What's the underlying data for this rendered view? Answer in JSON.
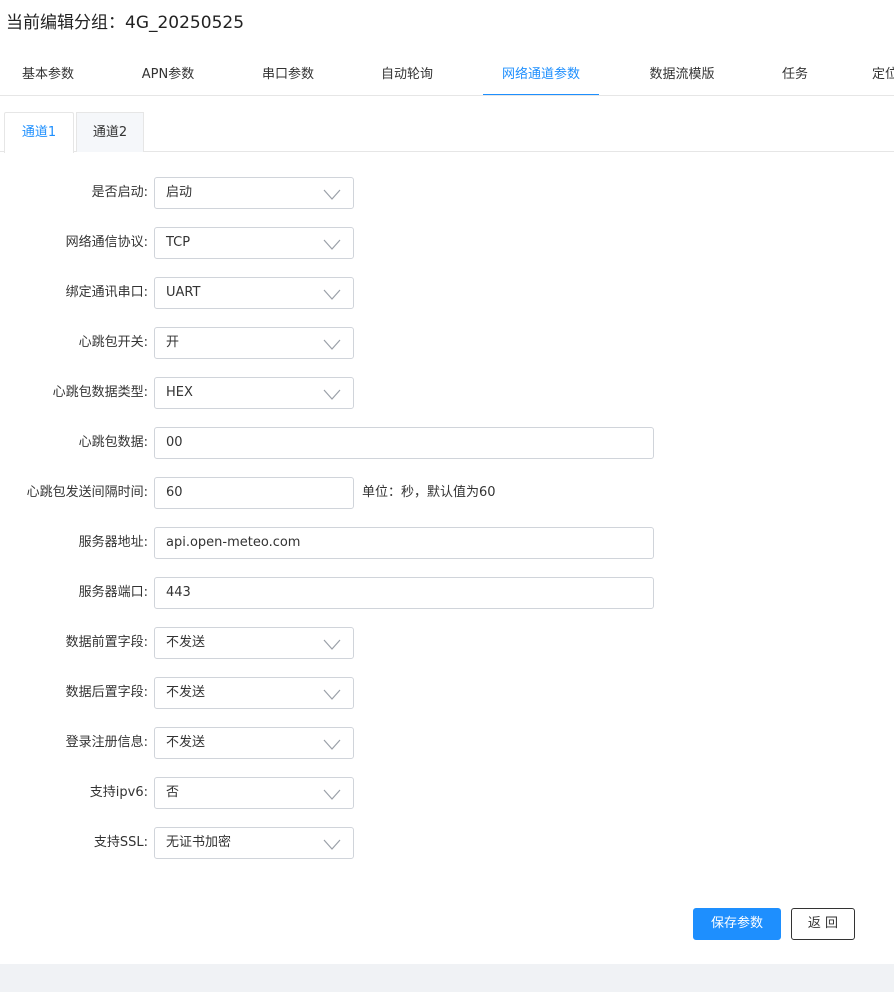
{
  "header": {
    "title": "当前编辑分组：4G_20250525"
  },
  "main_tabs": [
    {
      "label": "基本参数"
    },
    {
      "label": "APN参数"
    },
    {
      "label": "串口参数"
    },
    {
      "label": "自动轮询"
    },
    {
      "label": "网络通道参数",
      "active": true
    },
    {
      "label": "数据流模版"
    },
    {
      "label": "任务"
    },
    {
      "label": "定位"
    }
  ],
  "sub_tabs": [
    {
      "label": "通道1",
      "active": true
    },
    {
      "label": "通道2"
    }
  ],
  "form": {
    "enable": {
      "label": "是否启动:",
      "value": "启动"
    },
    "protocol": {
      "label": "网络通信协议:",
      "value": "TCP"
    },
    "serial": {
      "label": "绑定通讯串口:",
      "value": "UART"
    },
    "heartbeat_switch": {
      "label": "心跳包开关:",
      "value": "开"
    },
    "heartbeat_type": {
      "label": "心跳包数据类型:",
      "value": "HEX"
    },
    "heartbeat_data": {
      "label": "心跳包数据:",
      "value": "00"
    },
    "heartbeat_interval": {
      "label": "心跳包发送间隔时间:",
      "value": "60",
      "hint": "单位：秒，默认值为60"
    },
    "server_address": {
      "label": "服务器地址:",
      "value": "api.open-meteo.com"
    },
    "server_port": {
      "label": "服务器端口:",
      "value": "443"
    },
    "prefix_field": {
      "label": "数据前置字段:",
      "value": "不发送"
    },
    "suffix_field": {
      "label": "数据后置字段:",
      "value": "不发送"
    },
    "login_info": {
      "label": "登录注册信息:",
      "value": "不发送"
    },
    "ipv6": {
      "label": "支持ipv6:",
      "value": "否"
    },
    "ssl": {
      "label": "支持SSL:",
      "value": "无证书加密"
    }
  },
  "buttons": {
    "save": "保存参数",
    "back": "返 回"
  },
  "colors": {
    "accent": "#1e8ffe",
    "border": "#d0d4da",
    "footer": "#f0f2f5"
  }
}
